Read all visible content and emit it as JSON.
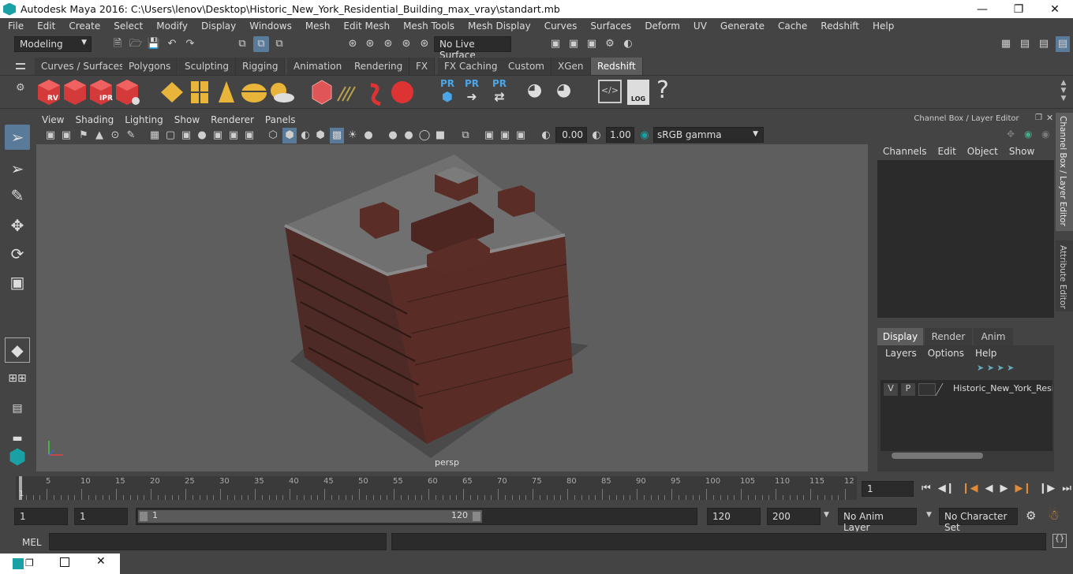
{
  "window": {
    "title": "Autodesk Maya 2016: C:\\Users\\lenov\\Desktop\\Historic_New_York_Residential_Building_max_vray\\standart.mb"
  },
  "menubar": [
    "File",
    "Edit",
    "Create",
    "Select",
    "Modify",
    "Display",
    "Windows",
    "Mesh",
    "Edit Mesh",
    "Mesh Tools",
    "Mesh Display",
    "Curves",
    "Surfaces",
    "Deform",
    "UV",
    "Generate",
    "Cache",
    "Redshift",
    "Help"
  ],
  "status": {
    "mode": "Modeling",
    "live_surface": "No Live Surface"
  },
  "shelf_tabs": [
    "Curves / Surfaces",
    "Polygons",
    "Sculpting",
    "Rigging",
    "Animation",
    "Rendering",
    "FX",
    "FX Caching",
    "Custom",
    "XGen",
    "Redshift"
  ],
  "shelf_active": "Redshift",
  "shelf_labels": {
    "rv": "RV",
    "ipr": "IPR",
    "pr1": "PR",
    "pr2": "PR",
    "pr3": "PR",
    "log": "LOG",
    "help": "?"
  },
  "viewport": {
    "menu": [
      "View",
      "Shading",
      "Lighting",
      "Show",
      "Renderer",
      "Panels"
    ],
    "exposure": "0.00",
    "gamma": "1.00",
    "colorspace": "sRGB gamma",
    "camera": "persp"
  },
  "channel_box": {
    "title": "Channel Box / Layer Editor",
    "menu": [
      "Channels",
      "Edit",
      "Object",
      "Show"
    ],
    "layer_tabs": [
      "Display",
      "Render",
      "Anim"
    ],
    "layer_tab_active": "Display",
    "layer_menu": [
      "Layers",
      "Options",
      "Help"
    ],
    "layer": {
      "v": "V",
      "p": "P",
      "name": "Historic_New_York_Resid"
    }
  },
  "side_tabs": [
    "Channel Box / Layer Editor",
    "Attribute Editor"
  ],
  "timeline": {
    "ticks": [
      "5",
      "10",
      "15",
      "20",
      "25",
      "30",
      "35",
      "40",
      "45",
      "50",
      "55",
      "60",
      "65",
      "70",
      "75",
      "80",
      "85",
      "90",
      "95",
      "100",
      "105",
      "110",
      "115",
      "12"
    ],
    "start_marker": "1",
    "current_frame": "1"
  },
  "range": {
    "start": "1",
    "playback_start": "1",
    "slider_start": "1",
    "slider_end": "120",
    "playback_end": "120",
    "end": "200",
    "anim_layer": "No Anim Layer",
    "char_set": "No Character Set"
  },
  "cmdline": {
    "label": "MEL"
  }
}
